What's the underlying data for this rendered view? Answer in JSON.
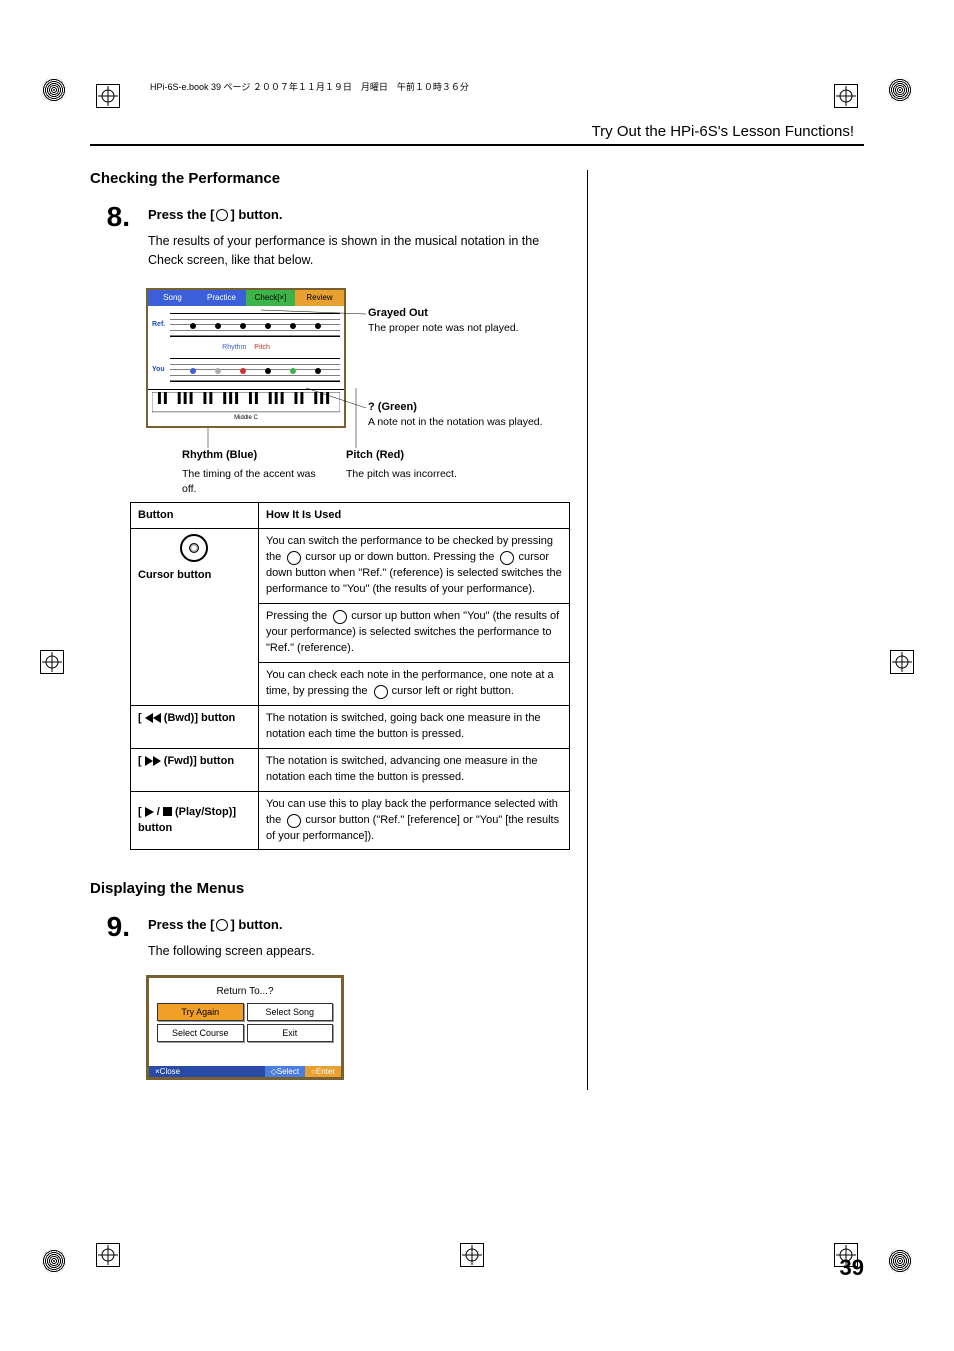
{
  "meta": {
    "header_line": "HPi-6S-e.book  39 ページ  ２００７年１１月１９日　月曜日　午前１０時３６分",
    "running_head": "Try Out the HPi-6S's Lesson Functions!",
    "page_number": "39"
  },
  "section8": {
    "title": "Checking the Performance",
    "step_num": "8.",
    "instruction_pre": "Press the [",
    "instruction_post": "] button.",
    "text": "The results of your performance is shown in the musical notation in the Check screen, like that below."
  },
  "lcd": {
    "tabs": {
      "song": "Song",
      "practice": "Practice",
      "check": "Check[×]",
      "review": "Review"
    },
    "ref_label": "Ref.",
    "you_label": "You",
    "rhythm": "Rhythm",
    "pitch": "Pitch",
    "middle_c": "Middle C"
  },
  "annotations": {
    "grayed_title": "Grayed Out",
    "grayed_text": "The proper note was not played.",
    "green_title": "? (Green)",
    "green_text": "A note not in the notation was played.",
    "rhythm_title": "Rhythm (Blue)",
    "rhythm_text": "The timing of the accent was off.",
    "pitch_title": "Pitch (Red)",
    "pitch_text": "The pitch was incorrect."
  },
  "table": {
    "headers": {
      "button": "Button",
      "how": "How It Is Used"
    },
    "cursor": {
      "label": "Cursor button",
      "r1a": "You can switch the performance to be checked by pressing the ",
      "r1b": " cursor up or down button. Pressing the ",
      "r1c": " cursor down button when \"Ref.\" (reference) is selected switches the performance to \"You\" (the results of your performance).",
      "r2a": "Pressing the ",
      "r2b": " cursor up button when \"You\" (the results of your performance) is selected switches the performance to \"Ref.\" (reference).",
      "r3a": "You can check each note in the performance, one note at a time, by pressing the ",
      "r3b": " cursor left or right button."
    },
    "bwd": {
      "label": " (Bwd)] button",
      "text": "The notation is switched, going back one measure in the notation each time the button is pressed."
    },
    "fwd": {
      "label": " (Fwd)] button",
      "text": "The notation is switched, advancing one measure in the notation each time the button is pressed."
    },
    "play": {
      "label_pre": "[",
      "label_mid": " (Play/Stop)] button",
      "text_a": "You can use this to play back the performance selected with the ",
      "text_b": " cursor button (\"Ref.\" [reference] or \"You\" [the results of your performance])."
    }
  },
  "section9": {
    "title": "Displaying the Menus",
    "step_num": "9.",
    "instruction_pre": "Press the [",
    "instruction_post": "] button.",
    "text": "The following screen appears."
  },
  "menu_screen": {
    "title": "Return To...?",
    "try_again": "Try Again",
    "select_song": "Select Song",
    "select_course": "Select Course",
    "exit": "Exit",
    "footer_close": "×Close",
    "footer_select": "◇Select",
    "footer_enter": "○Enter"
  }
}
